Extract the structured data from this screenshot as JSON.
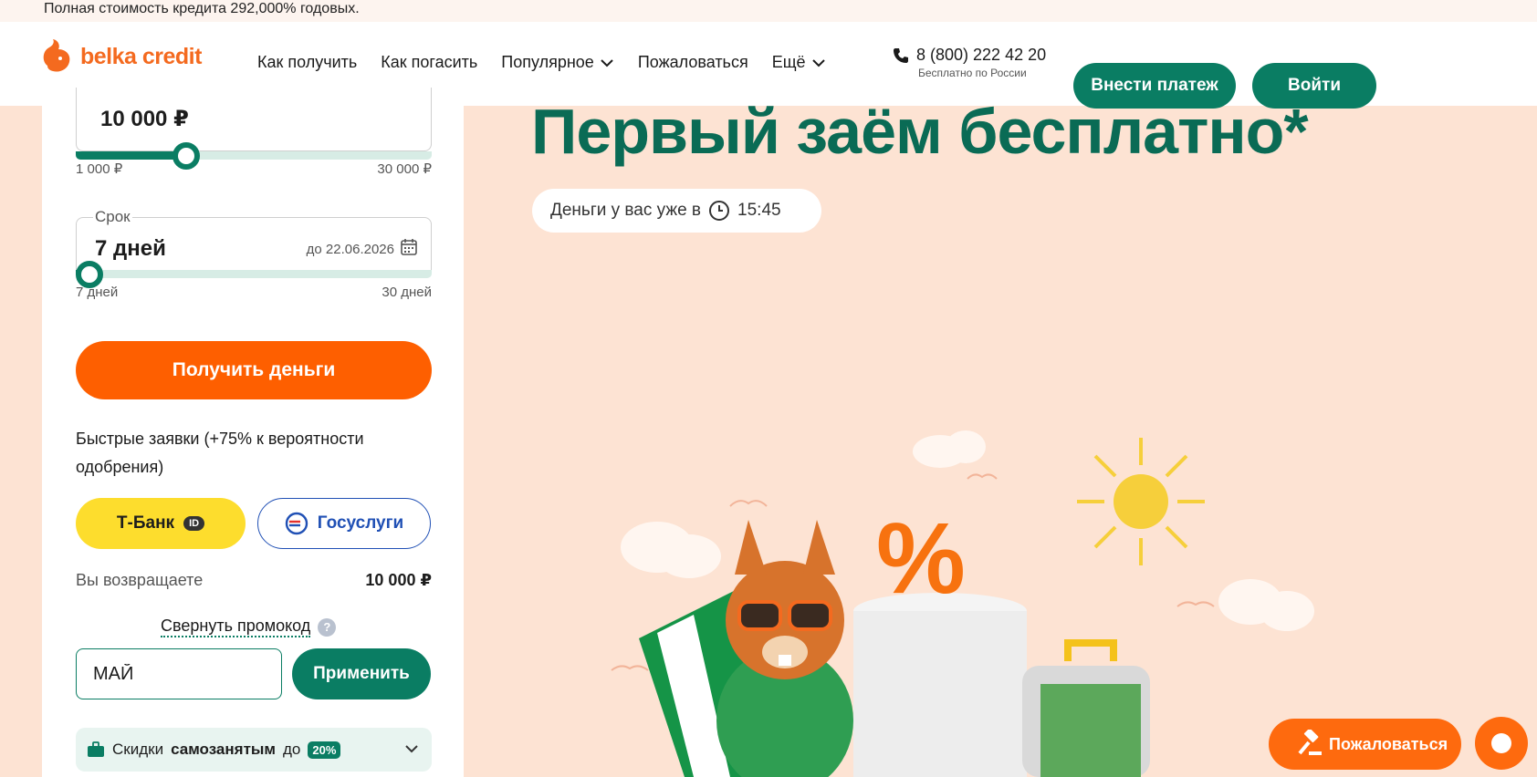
{
  "top_notice": "Полная стоимость кредита 292,000% годовых.",
  "header": {
    "logo_text": "belka credit",
    "nav": [
      {
        "label": "Как получить"
      },
      {
        "label": "Как погасить"
      },
      {
        "label": "Популярное",
        "icon": "chevron-down-icon"
      },
      {
        "label": "Пожаловаться"
      },
      {
        "label": "Ещё",
        "icon": "chevron-down-icon"
      }
    ],
    "phone": "8 (800) 222 42 20",
    "phone_sub": "Бесплатно по России",
    "pay_label": "Внести платеж",
    "login_label": "Войти"
  },
  "calculator": {
    "amount_value": "10 000 ₽",
    "amount_fraction": 0.31,
    "amount_min": "1 000 ₽",
    "amount_max": "30 000 ₽",
    "term_legend": "Срок",
    "term_value": "7 дней",
    "term_date": "до 22.06.2026",
    "term_fraction": 0.0,
    "term_min": "7 дней",
    "term_max": "30 дней",
    "submit_label": "Получить деньги",
    "fast_text": "Быстрые заявки (+75% к вероятности одобрения)",
    "tbank_label": "Т-Банк",
    "tbank_badge": "ID",
    "gosuslugi_label": "Госуслуги",
    "return_label": "Вы возвращаете",
    "return_value": "10 000 ₽",
    "promo_toggle": "Свернуть промокод",
    "promo_help": "?",
    "promo_value": "МАЙ",
    "apply_label": "Применить",
    "discount_prefix": "Скидки",
    "discount_bold": "самозанятым",
    "discount_mid": "до",
    "discount_pct": "20%"
  },
  "hero": {
    "title": "Первый заём бесплатно*",
    "chip_text": "Деньги у вас уже в",
    "chip_time": "15:45"
  },
  "floating": {
    "complain_label": "Пожаловаться"
  },
  "colors": {
    "brand_green": "#0a7d63",
    "brand_orange": "#fe5f00",
    "background": "#fde3d3"
  }
}
